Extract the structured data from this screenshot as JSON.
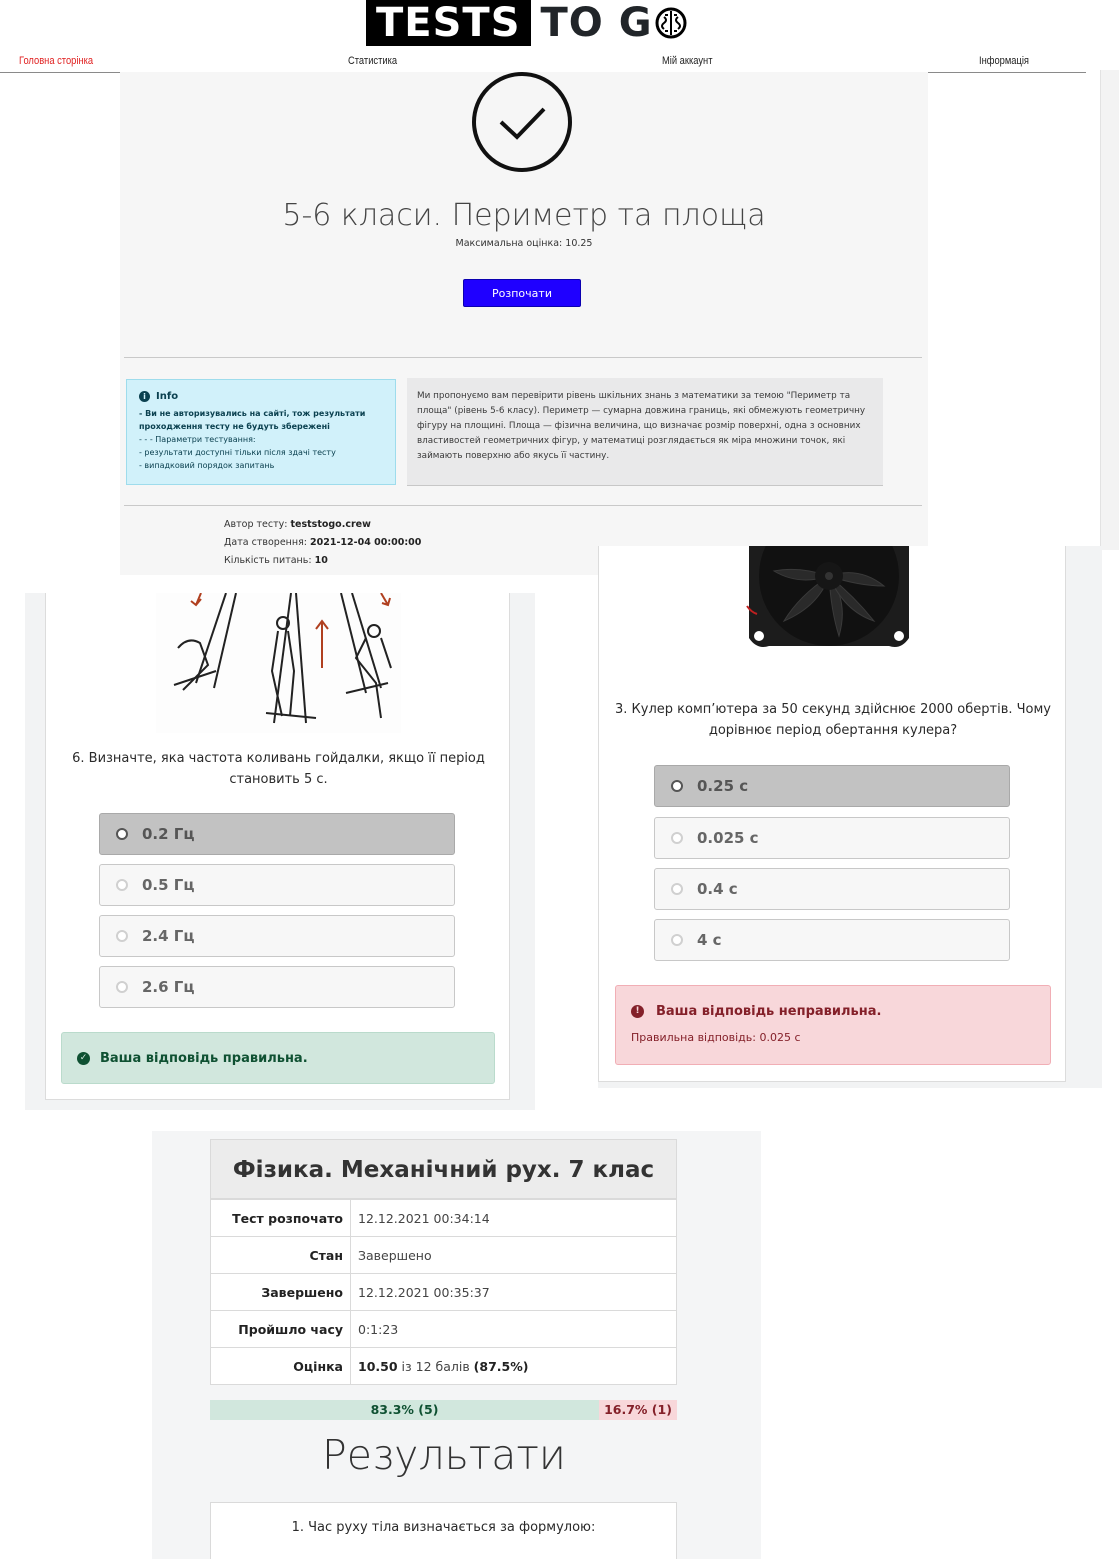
{
  "logo": {
    "boxed": "TESTS",
    "rest": "TO G"
  },
  "nav": [
    {
      "label": "Головна сторінка",
      "active": true
    },
    {
      "label": "Статистика",
      "active": false
    },
    {
      "label": "Мій аккаунт",
      "active": false
    },
    {
      "label": "Інформація",
      "active": false
    }
  ],
  "test_intro": {
    "title": "5-6 класи. Периметр та площа",
    "max_score": "Максимальна оцінка: 10.25",
    "start_button": "Розпочати",
    "info": {
      "title": "Info",
      "warning": "- Ви не авторизувались на сайті, тож результати проходження тесту не будуть збережені",
      "params_label": "- - - Параметри тестування:",
      "param1": "- результати доступні тільки після здачі тесту",
      "param2": "- випадковий порядок запитань"
    },
    "description": "Ми пропонуємо вам перевірити рівень шкільних знань з математики за темою \"Периметр та площа\" (рівень 5-6 класу). Периметр — сумарна довжина границь, які обмежують геометричну фігуру на площині. Площа — фізична величина, що визначає розмір поверхні, одна з основних властивостей геометричних фігур, у математиці розглядається як міра множини точок, які займають поверхню або якусь її частину.",
    "meta": {
      "author_label": "Автор тесту:",
      "author": "teststogo.crew",
      "created_label": "Дата створення:",
      "created": "2021-12-04 00:00:00",
      "count_label": "Кількість питань:",
      "count": "10"
    }
  },
  "question6": {
    "text": "6. Визначте, яка частота коливань гойдалки, якщо її період становить 5 с.",
    "options": [
      "0.2 Гц",
      "0.5 Гц",
      "2.4 Гц",
      "2.6 Гц"
    ],
    "selected": 0,
    "feedback": "Ваша відповідь правильна."
  },
  "question3": {
    "text": "3. Кулер комп’ютера за 50 секунд здійснює 2000 обертів. Чому дорівнює період обертання кулера?",
    "options": [
      "0.25 с",
      "0.025 с",
      "0.4 с",
      "4 с"
    ],
    "selected": 0,
    "feedback": "Ваша відповідь неправильна.",
    "correct": "Правильна відповідь: 0.025 с"
  },
  "results": {
    "title": "Фізика. Механічний рух. 7 клас",
    "rows": [
      {
        "key": "Тест розпочато",
        "value": "12.12.2021 00:34:14"
      },
      {
        "key": "Стан",
        "value": "Завершено"
      },
      {
        "key": "Завершено",
        "value": "12.12.2021 00:35:37"
      },
      {
        "key": "Пройшло часу",
        "value": "0:1:23"
      }
    ],
    "score_key": "Оцінка",
    "score_value": "10.50",
    "score_mid": " із 12 балів ",
    "score_pct": "(87.5%)",
    "correct_share": 0.833,
    "correct_label": "83.3% (5)",
    "wrong_label": "16.7% (1)",
    "section_title": "Результати",
    "first_question": "1. Час руху тіла визначається за формулою:"
  },
  "colors": {
    "primary_button": "#1f00ff",
    "nav_active": "#e02020",
    "success_bg": "#d1e7dd",
    "danger_bg": "#f8d7da",
    "info_bg": "#d1f1fa"
  }
}
